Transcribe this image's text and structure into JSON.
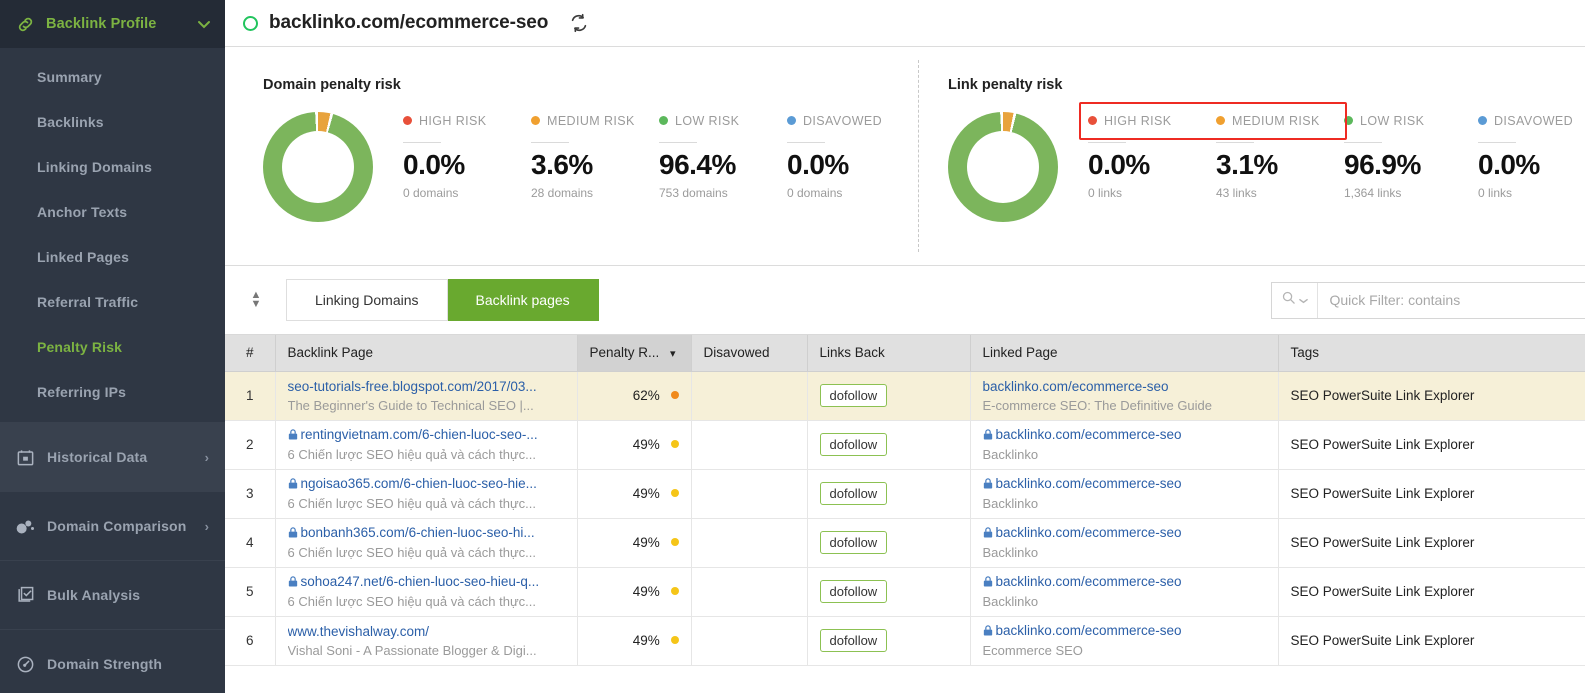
{
  "sidebar": {
    "header": {
      "title": "Backlink Profile",
      "icon": "link-icon",
      "caret": "chevron-down-icon"
    },
    "sub_items": [
      {
        "label": "Summary",
        "active": false
      },
      {
        "label": "Backlinks",
        "active": false
      },
      {
        "label": "Linking Domains",
        "active": false
      },
      {
        "label": "Anchor Texts",
        "active": false
      },
      {
        "label": "Linked Pages",
        "active": false
      },
      {
        "label": "Referral Traffic",
        "active": false
      },
      {
        "label": "Penalty Risk",
        "active": true
      },
      {
        "label": "Referring IPs",
        "active": false
      }
    ],
    "groups": [
      {
        "label": "Historical Data",
        "icon": "calendar-icon",
        "arrow": "›"
      },
      {
        "label": "Domain Comparison",
        "icon": "bubbles-icon",
        "arrow": "›"
      },
      {
        "label": "Bulk Analysis",
        "icon": "checklist-icon",
        "arrow": ""
      },
      {
        "label": "Domain Strength",
        "icon": "gauge-icon",
        "arrow": ""
      }
    ]
  },
  "topbar": {
    "url": "backlinko.com/ecommerce-seo",
    "status_icon": "green-circle-icon",
    "refresh_icon": "refresh-icon",
    "help_icon": "help-circle-icon",
    "alerts_icon": "calendar-bell-icon"
  },
  "colors": {
    "high_risk": "#e8503a",
    "medium_risk": "#f0a030",
    "low_risk": "#5cb85c",
    "disavowed": "#5b9bd5",
    "donut_green": "#7cb55c",
    "donut_orange": "#e8a33d",
    "accent_green": "#69a92f",
    "highlight_red": "#ee2b23",
    "row_highlight": "#f6f0d8"
  },
  "panels": [
    {
      "title": "Domain penalty risk",
      "unit": "domains",
      "highlight": false,
      "legend": [
        {
          "label": "HIGH RISK",
          "color": "#e8503a",
          "percent": "0.0%",
          "count": "0 domains"
        },
        {
          "label": "MEDIUM RISK",
          "color": "#f0a030",
          "percent": "3.6%",
          "count": "28 domains"
        },
        {
          "label": "LOW RISK",
          "color": "#5cb85c",
          "percent": "96.4%",
          "count": "753 domains"
        },
        {
          "label": "DISAVOWED",
          "color": "#5b9bd5",
          "percent": "0.0%",
          "count": "0 domains"
        }
      ]
    },
    {
      "title": "Link penalty risk",
      "unit": "links",
      "highlight": true,
      "legend": [
        {
          "label": "HIGH RISK",
          "color": "#e8503a",
          "percent": "0.0%",
          "count": "0 links"
        },
        {
          "label": "MEDIUM RISK",
          "color": "#f0a030",
          "percent": "3.1%",
          "count": "43 links"
        },
        {
          "label": "LOW RISK",
          "color": "#5cb85c",
          "percent": "96.9%",
          "count": "1,364 links"
        },
        {
          "label": "DISAVOWED",
          "color": "#5b9bd5",
          "percent": "0.0%",
          "count": "0 links"
        }
      ]
    }
  ],
  "chart_data": [
    {
      "type": "pie",
      "title": "Domain penalty risk",
      "labels": [
        "HIGH RISK",
        "MEDIUM RISK",
        "LOW RISK",
        "DISAVOWED"
      ],
      "values": [
        0.0,
        3.6,
        96.4,
        0.0
      ],
      "counts": [
        0,
        28,
        753,
        0
      ],
      "unit": "domains",
      "colors": [
        "#e8503a",
        "#f0a030",
        "#7cb55c",
        "#5b9bd5"
      ],
      "legend_position": "right"
    },
    {
      "type": "pie",
      "title": "Link penalty risk",
      "labels": [
        "HIGH RISK",
        "MEDIUM RISK",
        "LOW RISK",
        "DISAVOWED"
      ],
      "values": [
        0.0,
        3.1,
        96.9,
        0.0
      ],
      "counts": [
        0,
        43,
        1364,
        0
      ],
      "unit": "links",
      "colors": [
        "#e8503a",
        "#f0a030",
        "#7cb55c",
        "#5b9bd5"
      ],
      "legend_position": "right"
    }
  ],
  "toolbar": {
    "tabs": [
      {
        "label": "Linking Domains",
        "active": false
      },
      {
        "label": "Backlink pages",
        "active": true
      }
    ],
    "quick_filter_placeholder": "Quick Filter: contains",
    "quick_filter_value": "",
    "search_icon": "search-icon",
    "search_caret": "chevron-down-icon",
    "filter_icon": "funnel-icon",
    "clear_filter_icon": "clear-filter-icon",
    "export_icon": "download-icon"
  },
  "table": {
    "columns": [
      {
        "key": "idx",
        "label": "#"
      },
      {
        "key": "page",
        "label": "Backlink Page"
      },
      {
        "key": "penalty",
        "label": "Penalty R...",
        "sorted": true,
        "sort_icon": "▾"
      },
      {
        "key": "disavowed",
        "label": "Disavowed"
      },
      {
        "key": "links",
        "label": "Links Back"
      },
      {
        "key": "linked",
        "label": "Linked Page"
      },
      {
        "key": "tags",
        "label": "Tags"
      }
    ],
    "rows": [
      {
        "idx": "1",
        "page_url": "seo-tutorials-free.blogspot.com/2017/03...",
        "page_title": "The Beginner's Guide to Technical SEO |...",
        "page_secure": false,
        "penalty": "62%",
        "penalty_color": "#f08a1c",
        "disavowed": "",
        "links_back": "dofollow",
        "linked_url": "backlinko.com/ecommerce-seo",
        "linked_title": "E-commerce SEO: The Definitive Guide",
        "linked_secure": false,
        "tags": "SEO PowerSuite Link Explorer",
        "highlighted": true
      },
      {
        "idx": "2",
        "page_url": "rentingvietnam.com/6-chien-luoc-seo-...",
        "page_title": "6 Chiến lược SEO hiệu quả và cách thực...",
        "page_secure": true,
        "penalty": "49%",
        "penalty_color": "#f5c518",
        "disavowed": "",
        "links_back": "dofollow",
        "linked_url": "backlinko.com/ecommerce-seo",
        "linked_title": "Backlinko",
        "linked_secure": true,
        "tags": "SEO PowerSuite Link Explorer",
        "highlighted": false
      },
      {
        "idx": "3",
        "page_url": "ngoisao365.com/6-chien-luoc-seo-hie...",
        "page_title": "6 Chiến lược SEO hiệu quả và cách thực...",
        "page_secure": true,
        "penalty": "49%",
        "penalty_color": "#f5c518",
        "disavowed": "",
        "links_back": "dofollow",
        "linked_url": "backlinko.com/ecommerce-seo",
        "linked_title": "Backlinko",
        "linked_secure": true,
        "tags": "SEO PowerSuite Link Explorer",
        "highlighted": false
      },
      {
        "idx": "4",
        "page_url": "bonbanh365.com/6-chien-luoc-seo-hi...",
        "page_title": "6 Chiến lược SEO hiệu quả và cách thực...",
        "page_secure": true,
        "penalty": "49%",
        "penalty_color": "#f5c518",
        "disavowed": "",
        "links_back": "dofollow",
        "linked_url": "backlinko.com/ecommerce-seo",
        "linked_title": "Backlinko",
        "linked_secure": true,
        "tags": "SEO PowerSuite Link Explorer",
        "highlighted": false
      },
      {
        "idx": "5",
        "page_url": "sohoa247.net/6-chien-luoc-seo-hieu-q...",
        "page_title": "6 Chiến lược SEO hiệu quả và cách thực...",
        "page_secure": true,
        "penalty": "49%",
        "penalty_color": "#f5c518",
        "disavowed": "",
        "links_back": "dofollow",
        "linked_url": "backlinko.com/ecommerce-seo",
        "linked_title": "Backlinko",
        "linked_secure": true,
        "tags": "SEO PowerSuite Link Explorer",
        "highlighted": false
      },
      {
        "idx": "6",
        "page_url": "www.thevishalway.com/",
        "page_title": "Vishal Soni - A Passionate Blogger & Digi...",
        "page_secure": false,
        "penalty": "49%",
        "penalty_color": "#f5c518",
        "disavowed": "",
        "links_back": "dofollow",
        "linked_url": "backlinko.com/ecommerce-seo",
        "linked_title": "Ecommerce SEO",
        "linked_secure": true,
        "tags": "SEO PowerSuite Link Explorer",
        "highlighted": false
      }
    ]
  }
}
